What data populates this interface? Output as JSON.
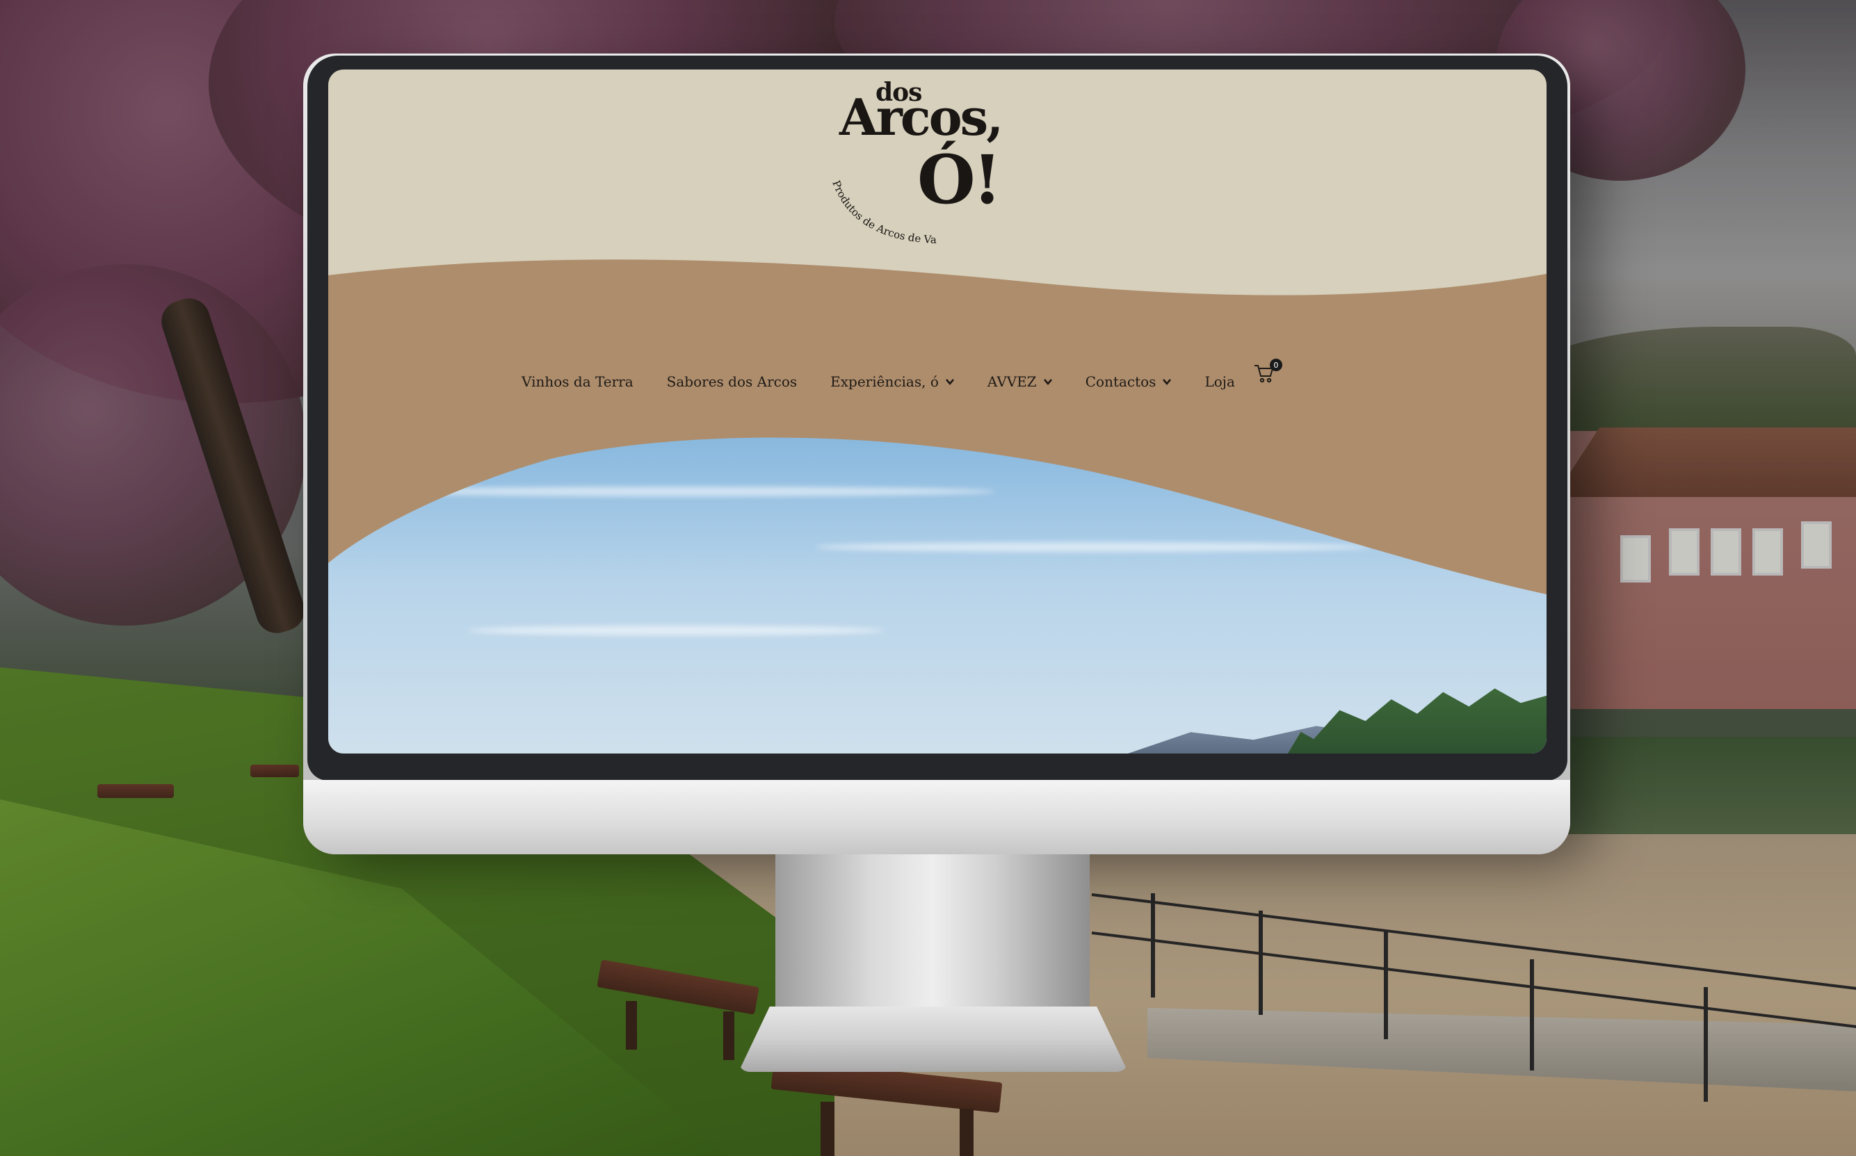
{
  "site": {
    "logo": {
      "line1": "dos",
      "line2": "Arcos,",
      "line3": "Ó!",
      "tagline": "Produtos de Arcos de Valdevez"
    },
    "nav": {
      "items": [
        {
          "label": "Vinhos da Terra",
          "has_dropdown": false
        },
        {
          "label": "Sabores dos Arcos",
          "has_dropdown": false
        },
        {
          "label": "Experiências, ó",
          "has_dropdown": true
        },
        {
          "label": "AVVEZ",
          "has_dropdown": true
        },
        {
          "label": "Contactos",
          "has_dropdown": true
        },
        {
          "label": "Loja",
          "has_dropdown": false
        }
      ],
      "cart_count": "0"
    }
  },
  "colors": {
    "header_bg": "#d6d0bc",
    "band_brown": "#ae8d6c",
    "text_dark": "#1e1a16"
  },
  "icons": [
    "chevron-down-icon",
    "shopping-cart-icon"
  ]
}
